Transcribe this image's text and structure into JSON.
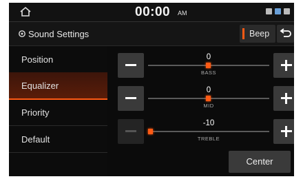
{
  "status_bar": {
    "time": "00:00",
    "ampm": "AM"
  },
  "header": {
    "title": "Sound Settings",
    "beep_label": "Beep"
  },
  "sidebar": {
    "items": [
      {
        "label": "Position"
      },
      {
        "label": "Equalizer"
      },
      {
        "label": "Priority"
      },
      {
        "label": "Default"
      }
    ]
  },
  "equalizer": {
    "bands": [
      {
        "label": "BASS",
        "value": "0"
      },
      {
        "label": "MID",
        "value": "0"
      },
      {
        "label": "TREBLE",
        "value": "-10"
      }
    ]
  },
  "footer": {
    "center_label": "Center"
  },
  "colors": {
    "accent": "#ff5a14",
    "background": "#0b0b0b",
    "button": "#3a3a3a"
  }
}
